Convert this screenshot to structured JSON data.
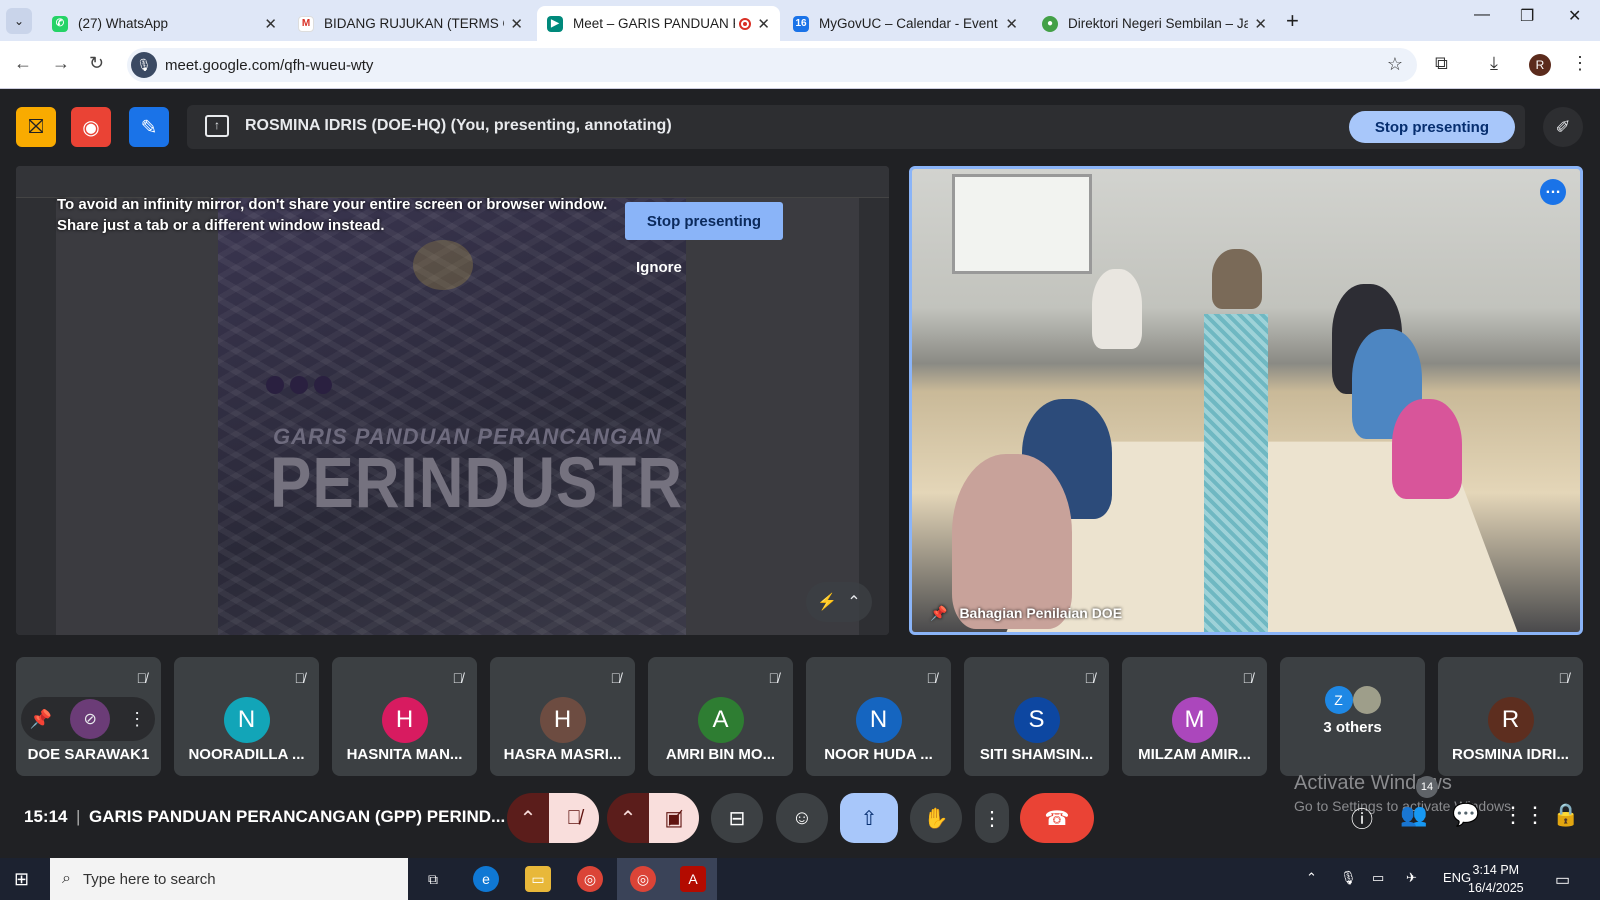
{
  "tabs": [
    {
      "label": "(27) WhatsApp",
      "icon": "whatsapp-icon"
    },
    {
      "label": "BIDANG RUJUKAN (TERMS OF R",
      "icon": "gmail-icon"
    },
    {
      "label": "Meet – GARIS PANDUAN PE",
      "icon": "meet-icon",
      "active": true
    },
    {
      "label": "MyGovUC – Calendar - Event de",
      "icon": "calendar-icon"
    },
    {
      "label": "Direktori Negeri Sembilan – Jab",
      "icon": "directory-icon"
    }
  ],
  "address": {
    "url": "meet.google.com/qfh-wueu-wty",
    "profile_initial": "R"
  },
  "presenting": {
    "text": "ROSMINA IDRIS (DOE-HQ) (You, presenting, annotating)",
    "stop_label": "Stop presenting"
  },
  "share": {
    "warning_line1": "To avoid an infinity mirror, don't share your entire screen or browser window.",
    "warning_line2": "Share just a tab or a different window instead.",
    "stop_label": "Stop presenting",
    "ignore_label": "Ignore",
    "slide_subtitle": "GARIS PANDUAN PERANCANGAN",
    "slide_title": "PERINDUSTRIAN"
  },
  "camera": {
    "name": "Bahagian Penilaian DOE"
  },
  "participants": [
    {
      "name": "DOE SARAWAK1",
      "initial": "",
      "color": ""
    },
    {
      "name": "NOORADILLA ...",
      "initial": "N",
      "color": "#12a5b8"
    },
    {
      "name": "HASNITA MAN...",
      "initial": "H",
      "color": "#d81b60"
    },
    {
      "name": "HASRA MASRI...",
      "initial": "H",
      "color": "#6d4c41"
    },
    {
      "name": "AMRI BIN MO...",
      "initial": "A",
      "color": "#2e7d32"
    },
    {
      "name": "NOOR HUDA ...",
      "initial": "N",
      "color": "#1565c0"
    },
    {
      "name": "SITI SHAMSIN...",
      "initial": "S",
      "color": "#0d47a1"
    },
    {
      "name": "MILZAM AMIR...",
      "initial": "M",
      "color": "#ab47bc"
    },
    {
      "name": "ROSMINA IDRI...",
      "initial": "R",
      "color": "#5d2e1f"
    }
  ],
  "others": {
    "label": "3 others",
    "initial": "Z"
  },
  "meeting": {
    "time": "15:14",
    "title": "GARIS PANDUAN PERANCANGAN (GPP) PERIND...",
    "people_count": "14"
  },
  "watermark": {
    "line1": "Activate Windows",
    "line2": "Go to Settings to activate Windows."
  },
  "taskbar": {
    "search_placeholder": "Type here to search",
    "lang": "ENG",
    "time": "3:14 PM",
    "date": "16/4/2025"
  }
}
